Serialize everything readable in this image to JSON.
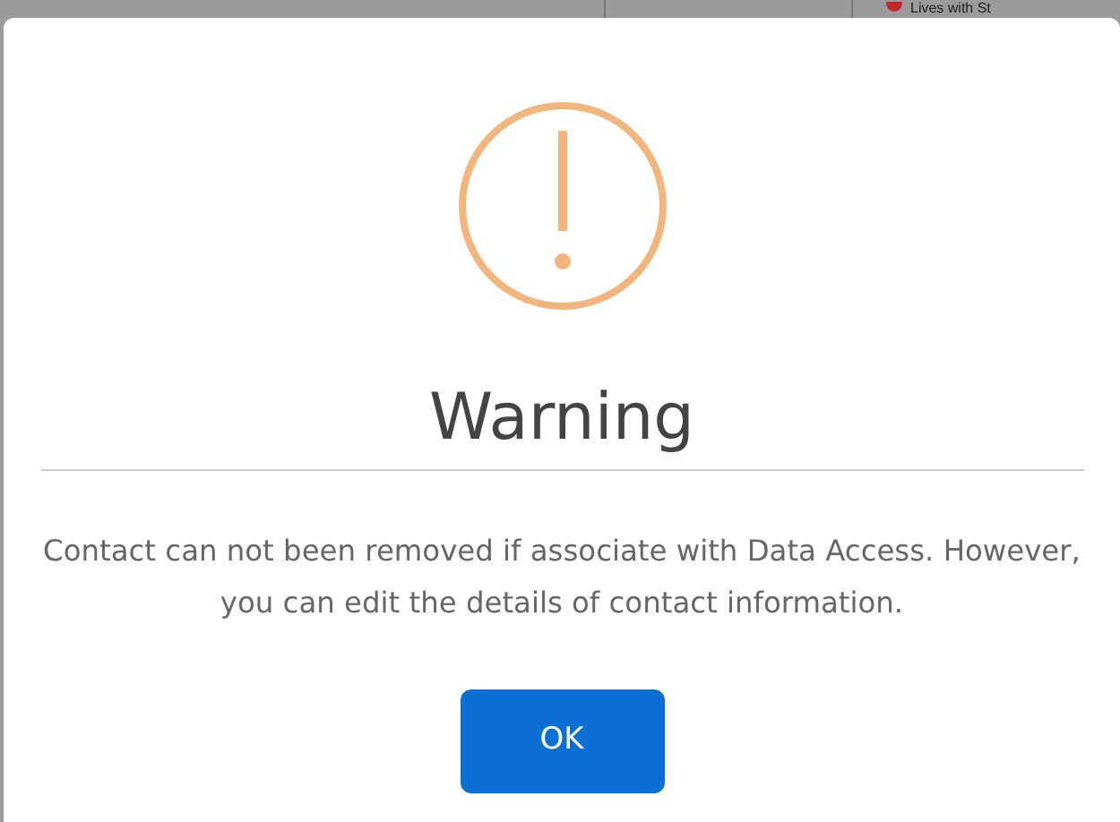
{
  "background": {
    "label": "Lives with St"
  },
  "dialog": {
    "title": "Warning",
    "message": "Contact can not been removed if associate with Data Access. However, you can edit the details of contact information.",
    "buttons": [
      {
        "label": "OK"
      }
    ]
  }
}
